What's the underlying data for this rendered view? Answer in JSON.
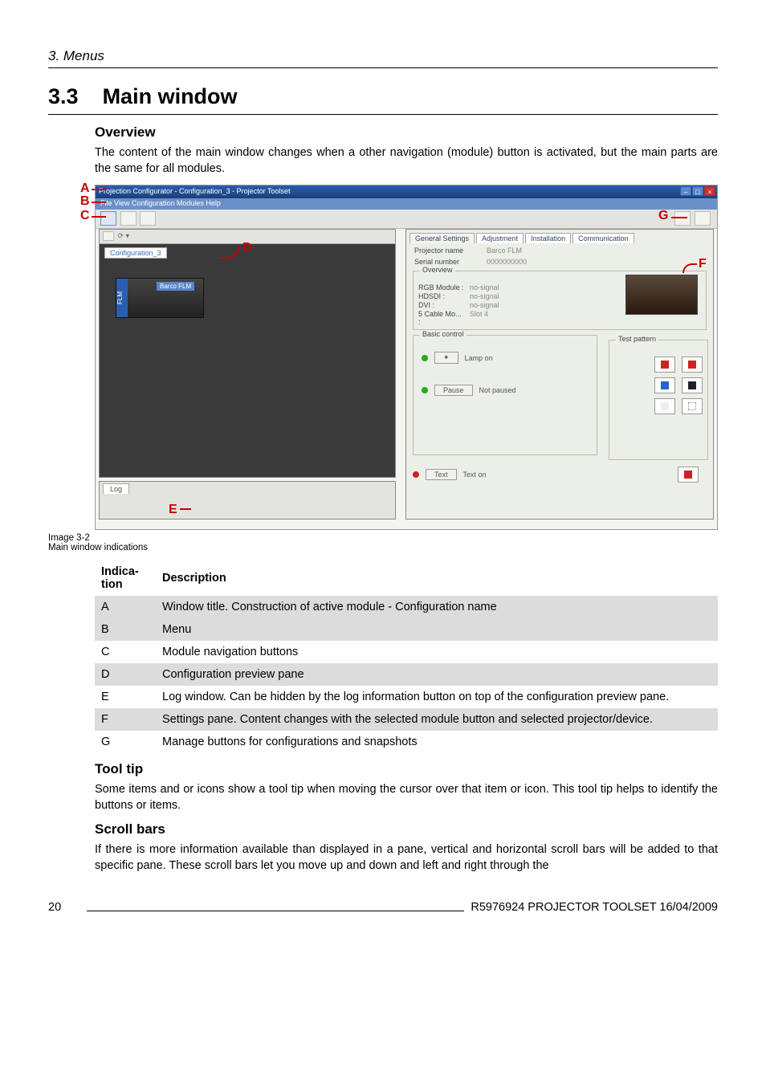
{
  "running_head": "3.  Menus",
  "section_number": "3.3",
  "section_title": "Main window",
  "overview": {
    "heading": "Overview",
    "paragraph": "The content of the main window changes when a other navigation (module) button is activated, but the main parts are the same for all modules."
  },
  "screenshot": {
    "window_title": "Projection Configurator - Configuration_3 - Projector Toolset",
    "menus": "File   View   Configuration   Modules   Help",
    "config_tab": "Configuration_3",
    "projector_side": "FLM",
    "projector_label": "Barco FLM",
    "log_tab": "Log",
    "right_tabs": {
      "t1": "General Settings",
      "t2": "Adjustment",
      "t3": "Installation",
      "t4": "Communication"
    },
    "fields": {
      "name_label": "Projector name",
      "name_value": "Barco FLM",
      "serial_label": "Serial number",
      "serial_value": "0000000000"
    },
    "overview_group": {
      "title": "Overview",
      "rows": [
        {
          "k": "RGB Module :",
          "v": "no-signal"
        },
        {
          "k": "HDSDI :",
          "v": "no-signal"
        },
        {
          "k": "DVI :",
          "v": "no-signal"
        },
        {
          "k": "5 Cable Mo... :",
          "v": "Slot 4"
        }
      ]
    },
    "basic_control": {
      "title": "Basic control",
      "lamp_btn": "✦",
      "lamp_status": "Lamp on",
      "pause_btn": "Pause",
      "pause_status": "Not paused",
      "text_btn": "Text",
      "text_status": "Text on"
    },
    "test_pattern_title": "Test pattern"
  },
  "callouts": {
    "a": "A",
    "b": "B",
    "c": "C",
    "d": "D",
    "e": "E",
    "f": "F",
    "g": "G"
  },
  "caption_id": "Image 3-2",
  "caption_text": "Main window indications",
  "table": {
    "head_a": "Indica-\ntion",
    "head_b": "Description",
    "rows": [
      {
        "k": "A",
        "v": "Window title.  Construction of active module - Configuration name"
      },
      {
        "k": "B",
        "v": "Menu"
      },
      {
        "k": "C",
        "v": "Module navigation buttons"
      },
      {
        "k": "D",
        "v": "Configuration preview pane"
      },
      {
        "k": "E",
        "v": "Log window.  Can be hidden by the log information button on top of the configuration preview pane."
      },
      {
        "k": "F",
        "v": "Settings pane.  Content changes with the selected module button and selected projector/device."
      },
      {
        "k": "G",
        "v": "Manage buttons for configurations and snapshots"
      }
    ]
  },
  "tooltip": {
    "heading": "Tool tip",
    "paragraph": "Some items and or icons show a tool tip when moving the cursor over that item or icon.  This tool tip helps to identify the buttons or items."
  },
  "scrollbars": {
    "heading": "Scroll bars",
    "paragraph": "If there is more information available than displayed in a pane, vertical and horizontal scroll bars will be added to that specific pane.  These scroll bars let you move up and down and left and right through the"
  },
  "footer": {
    "page": "20",
    "doc": "R5976924   PROJECTOR TOOLSET  16/04/2009"
  }
}
